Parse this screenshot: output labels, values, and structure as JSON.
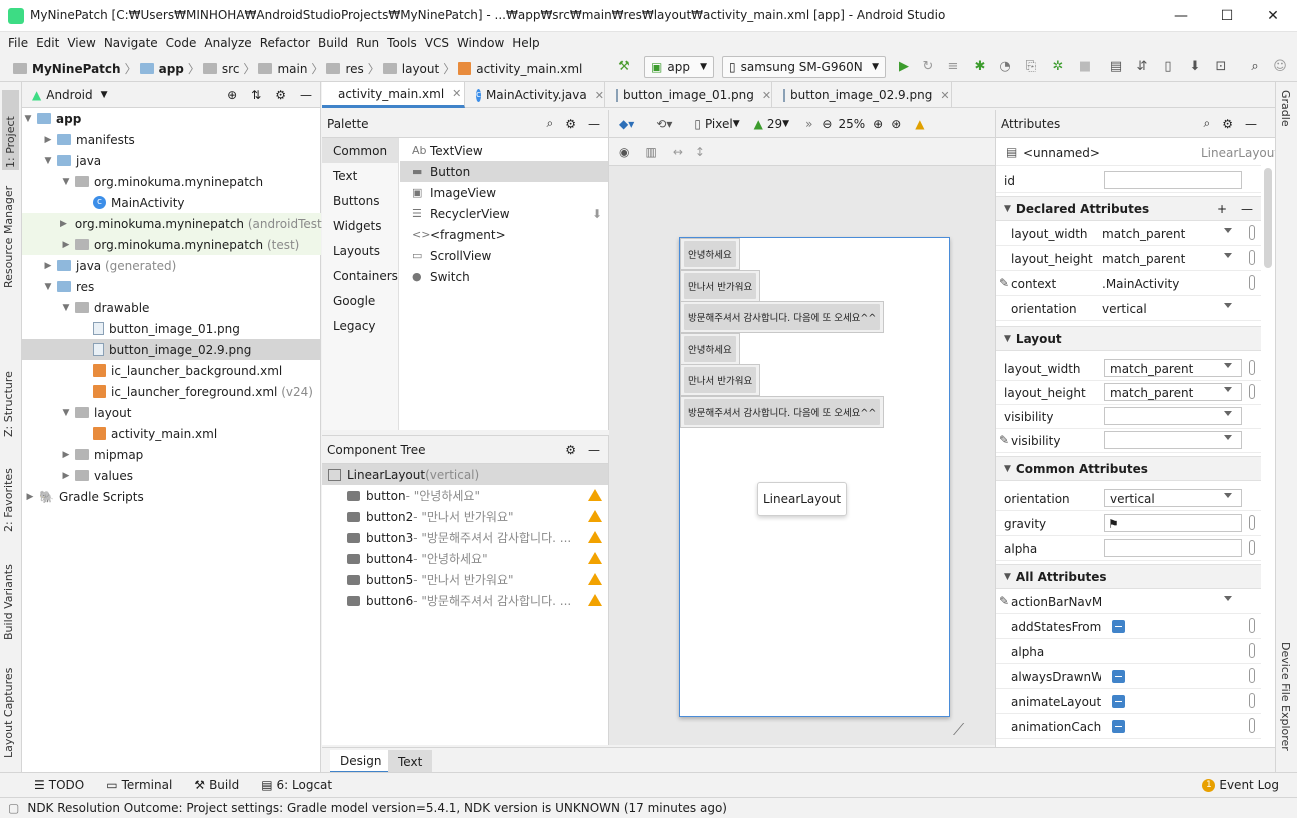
{
  "window": {
    "title": "MyNinePatch [C:₩Users₩MINHOHA₩AndroidStudioProjects₩MyNinePatch] - ...₩app₩src₩main₩res₩layout₩activity_main.xml [app] - Android Studio",
    "minimize": "—",
    "maximize": "☐",
    "close": "✕"
  },
  "menu": [
    "File",
    "Edit",
    "View",
    "Navigate",
    "Code",
    "Analyze",
    "Refactor",
    "Build",
    "Run",
    "Tools",
    "VCS",
    "Window",
    "Help"
  ],
  "breadcrumbs": [
    "MyNinePatch",
    "app",
    "src",
    "main",
    "res",
    "layout",
    "activity_main.xml"
  ],
  "toolbar": {
    "config": "app",
    "device": "samsung SM-G960N"
  },
  "project": {
    "view": "Android",
    "tree": [
      {
        "label": "app",
        "bold": true
      },
      {
        "label": "manifests"
      },
      {
        "label": "java"
      },
      {
        "label": "org.minokuma.myninepatch"
      },
      {
        "label": "MainActivity"
      },
      {
        "label": "org.minokuma.myninepatch",
        "suffix": "(androidTest)"
      },
      {
        "label": "org.minokuma.myninepatch",
        "suffix": "(test)"
      },
      {
        "label": "java",
        "suffix": "(generated)"
      },
      {
        "label": "res"
      },
      {
        "label": "drawable"
      },
      {
        "label": "button_image_01.png"
      },
      {
        "label": "button_image_02.9.png"
      },
      {
        "label": "ic_launcher_background.xml"
      },
      {
        "label": "ic_launcher_foreground.xml",
        "suffix": "(v24)"
      },
      {
        "label": "layout"
      },
      {
        "label": "activity_main.xml"
      },
      {
        "label": "mipmap"
      },
      {
        "label": "values"
      },
      {
        "label": "Gradle Scripts"
      }
    ]
  },
  "editor_tabs": [
    "activity_main.xml",
    "MainActivity.java",
    "button_image_01.png",
    "button_image_02.9.png"
  ],
  "palette": {
    "title": "Palette",
    "categories": [
      "Common",
      "Text",
      "Buttons",
      "Widgets",
      "Layouts",
      "Containers",
      "Google",
      "Legacy"
    ],
    "items": [
      {
        "icon": "Ab",
        "label": "TextView"
      },
      {
        "icon": "▬",
        "label": "Button"
      },
      {
        "icon": "▣",
        "label": "ImageView"
      },
      {
        "icon": "☰",
        "label": "RecyclerView"
      },
      {
        "icon": "<>",
        "label": "<fragment>"
      },
      {
        "icon": "▭",
        "label": "ScrollView"
      },
      {
        "icon": "●",
        "label": "Switch"
      }
    ]
  },
  "component_tree": {
    "title": "Component Tree",
    "root": "LinearLayout",
    "root_suffix": "(vertical)",
    "children": [
      {
        "id": "button",
        "text": "- \"안녕하세요\""
      },
      {
        "id": "button2",
        "text": "- \"만나서 반가워요\""
      },
      {
        "id": "button3",
        "text": "- \"방문해주셔서 감사합니다. ..."
      },
      {
        "id": "button4",
        "text": "- \"안녕하세요\""
      },
      {
        "id": "button5",
        "text": "- \"만나서 반가워요\""
      },
      {
        "id": "button6",
        "text": "- \"방문해주셔서 감사합니다. ..."
      }
    ]
  },
  "design": {
    "device": "Pixel",
    "api": "29",
    "zoom": "25%",
    "buttons": [
      "안녕하세요",
      "만나서 반가워요",
      "방문해주셔서 감사합니다. 다음에 또 오세요^^",
      "안녕하세요",
      "만나서 반가워요",
      "방문해주셔서 감사합니다. 다음에 또 오세요^^"
    ],
    "tooltip": "LinearLayout"
  },
  "bottom_tabs": [
    "Design",
    "Text"
  ],
  "attributes": {
    "title": "Attributes",
    "component": "<unnamed>",
    "component_type": "LinearLayout",
    "id_label": "id",
    "declared_title": "Declared Attributes",
    "declared": [
      {
        "k": "layout_width",
        "v": "match_parent"
      },
      {
        "k": "layout_height",
        "v": "match_parent"
      },
      {
        "k": "context",
        "v": ".MainActivity"
      },
      {
        "k": "orientation",
        "v": "vertical"
      }
    ],
    "layout_title": "Layout",
    "layout": [
      {
        "k": "layout_width",
        "v": "match_parent"
      },
      {
        "k": "layout_height",
        "v": "match_parent"
      },
      {
        "k": "visibility",
        "v": ""
      },
      {
        "k": "visibility",
        "v": ""
      }
    ],
    "common_title": "Common Attributes",
    "common": [
      {
        "k": "orientation",
        "v": "vertical"
      },
      {
        "k": "gravity",
        "v": "⚑"
      },
      {
        "k": "alpha",
        "v": ""
      }
    ],
    "all_title": "All Attributes",
    "all": [
      {
        "k": "actionBarNavMod"
      },
      {
        "k": "addStatesFromCh"
      },
      {
        "k": "alpha"
      },
      {
        "k": "alwaysDrawnWithC"
      },
      {
        "k": "animateLayoutCha"
      },
      {
        "k": "animationCache"
      }
    ]
  },
  "toolwindows": [
    "TODO",
    "Terminal",
    "Build",
    "6: Logcat"
  ],
  "event_log": {
    "count": "1",
    "label": "Event Log"
  },
  "status": "NDK Resolution Outcome: Project settings: Gradle model version=5.4.1, NDK version is UNKNOWN (17 minutes ago)",
  "side_tabs_left": [
    "1: Project",
    "Resource Manager",
    "Z: Structure",
    "2: Favorites",
    "Build Variants",
    "Layout Captures"
  ],
  "side_tabs_right": [
    "Gradle",
    "Device File Explorer"
  ]
}
